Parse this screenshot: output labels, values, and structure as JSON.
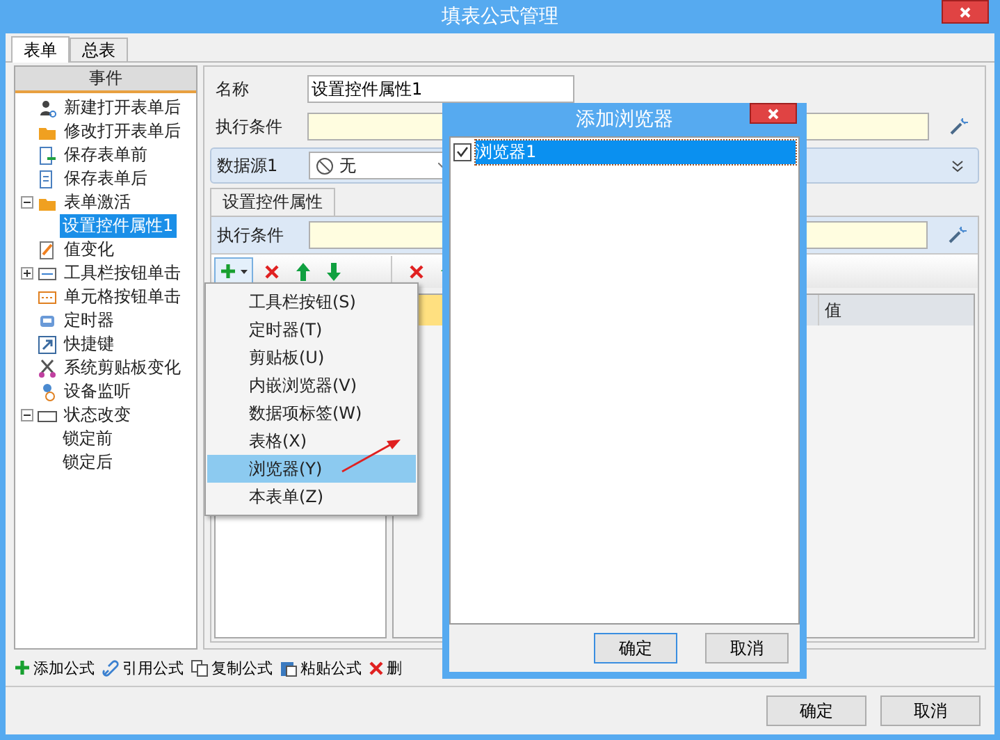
{
  "window": {
    "title": "填表公式管理"
  },
  "tabs": [
    {
      "label": "表单",
      "selected": true
    },
    {
      "label": "总表",
      "selected": false
    }
  ],
  "events": {
    "header": "事件",
    "items": [
      {
        "label": "新建打开表单后",
        "selected": false
      },
      {
        "label": "修改打开表单后",
        "selected": false
      },
      {
        "label": "保存表单前",
        "selected": false
      },
      {
        "label": "保存表单后",
        "selected": false
      },
      {
        "label": "表单激活",
        "selected": false,
        "expanded": true,
        "children": [
          {
            "label": "设置控件属性1",
            "selected": true
          }
        ]
      },
      {
        "label": "值变化",
        "selected": false
      },
      {
        "label": "工具栏按钮单击",
        "selected": false,
        "expanded": false
      },
      {
        "label": "单元格按钮单击",
        "selected": false
      },
      {
        "label": "定时器",
        "selected": false
      },
      {
        "label": "快捷键",
        "selected": false
      },
      {
        "label": "系统剪贴板变化",
        "selected": false
      },
      {
        "label": "设备监听",
        "selected": false
      },
      {
        "label": "状态改变",
        "selected": false,
        "expanded": true,
        "children": [
          {
            "label": "锁定前",
            "selected": false
          },
          {
            "label": "锁定后",
            "selected": false
          }
        ]
      }
    ]
  },
  "formula": {
    "name_label": "名称",
    "name_value": "设置控件属性1",
    "condition_label": "执行条件",
    "datasource": {
      "label": "数据源1",
      "value": "无"
    }
  },
  "action": {
    "tab": "设置控件属性",
    "condition_label": "执行条件",
    "table_columns": [
      "值"
    ]
  },
  "add_menu": {
    "items": [
      {
        "label": "工具栏按钮(S)",
        "selected": false
      },
      {
        "label": "定时器(T)",
        "selected": false
      },
      {
        "label": "剪贴板(U)",
        "selected": false
      },
      {
        "label": "内嵌浏览器(V)",
        "selected": false
      },
      {
        "label": "数据项标签(W)",
        "selected": false
      },
      {
        "label": "表格(X)",
        "selected": false
      },
      {
        "label": "浏览器(Y)",
        "selected": true
      },
      {
        "label": "本表单(Z)",
        "selected": false
      }
    ]
  },
  "bottom_toolbar": [
    {
      "label": "添加公式"
    },
    {
      "label": "引用公式"
    },
    {
      "label": "复制公式"
    },
    {
      "label": "粘贴公式"
    },
    {
      "label": "删"
    }
  ],
  "buttons": [
    "确定",
    "取消"
  ],
  "dialog": {
    "title": "添加浏览器",
    "items": [
      {
        "label": "浏览器1",
        "checked": true,
        "selected": true
      }
    ],
    "buttons": [
      "确定",
      "取消"
    ]
  }
}
